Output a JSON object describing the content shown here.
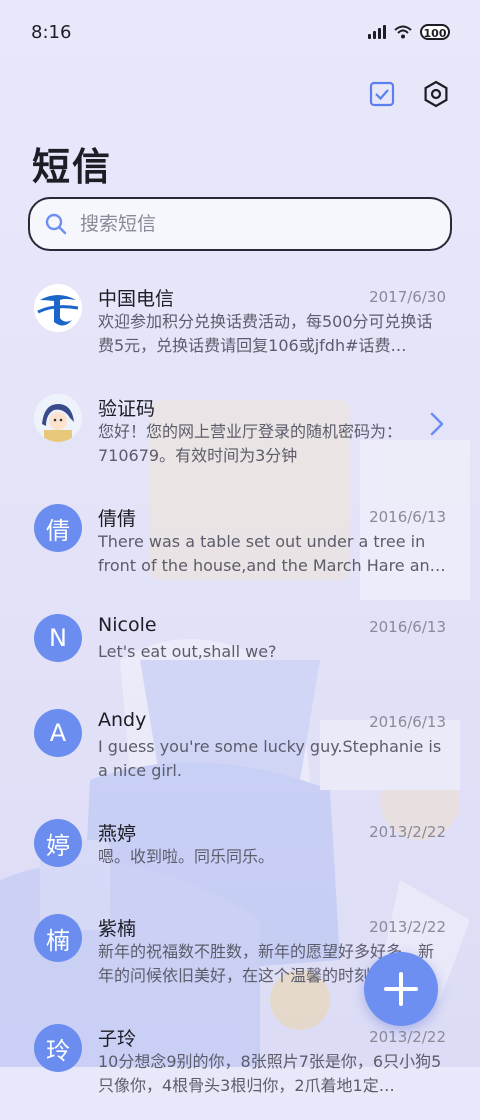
{
  "status_bar": {
    "time": "8:16",
    "battery": "100"
  },
  "header": {
    "title": "短信"
  },
  "search": {
    "placeholder": "搜索短信"
  },
  "conversations": [
    {
      "name": "中国电信",
      "date": "2017/6/30",
      "preview": "欢迎参加积分兑换话费活动，每500分可兑换话费5元，兑换话费请回复106或jfdh#话费…",
      "avatar": "telecom-logo"
    },
    {
      "name": "验证码",
      "date": "",
      "preview": "您好！您的网上营业厅登录的随机密码为：710679。有效时间为3分钟",
      "avatar": "anime-avatar"
    },
    {
      "name": "倩倩",
      "date": "2016/6/13",
      "preview": "There was a table set out under a tree in front of the house,and the March Hare an…",
      "avatar_letter": "倩"
    },
    {
      "name": "Nicole",
      "date": "2016/6/13",
      "preview": "Let's eat out,shall we?",
      "avatar_letter": "N"
    },
    {
      "name": "Andy",
      "date": "2016/6/13",
      "preview": "I guess you're some lucky guy.Stephanie is a nice girl.",
      "avatar_letter": "A"
    },
    {
      "name": "燕婷",
      "date": "2013/2/22",
      "preview": "嗯。收到啦。同乐同乐。",
      "avatar_letter": "婷"
    },
    {
      "name": "紫楠",
      "date": "2013/2/22",
      "preview": "新年的祝福数不胜数，新年的愿望好多好多，新年的问候依旧美好，在这个温馨的时刻…",
      "avatar_letter": "楠"
    },
    {
      "name": "子玲",
      "date": "2013/2/22",
      "preview": "10分想念9别的你，8张照片7张是你，6只小狗5只像你，4根骨头3根归你，2爪着地1定…",
      "avatar_letter": "玲"
    }
  ],
  "colors": {
    "accent": "#6d8ff2",
    "avatar": "#6b8df0",
    "background": "#e6e5f9"
  }
}
